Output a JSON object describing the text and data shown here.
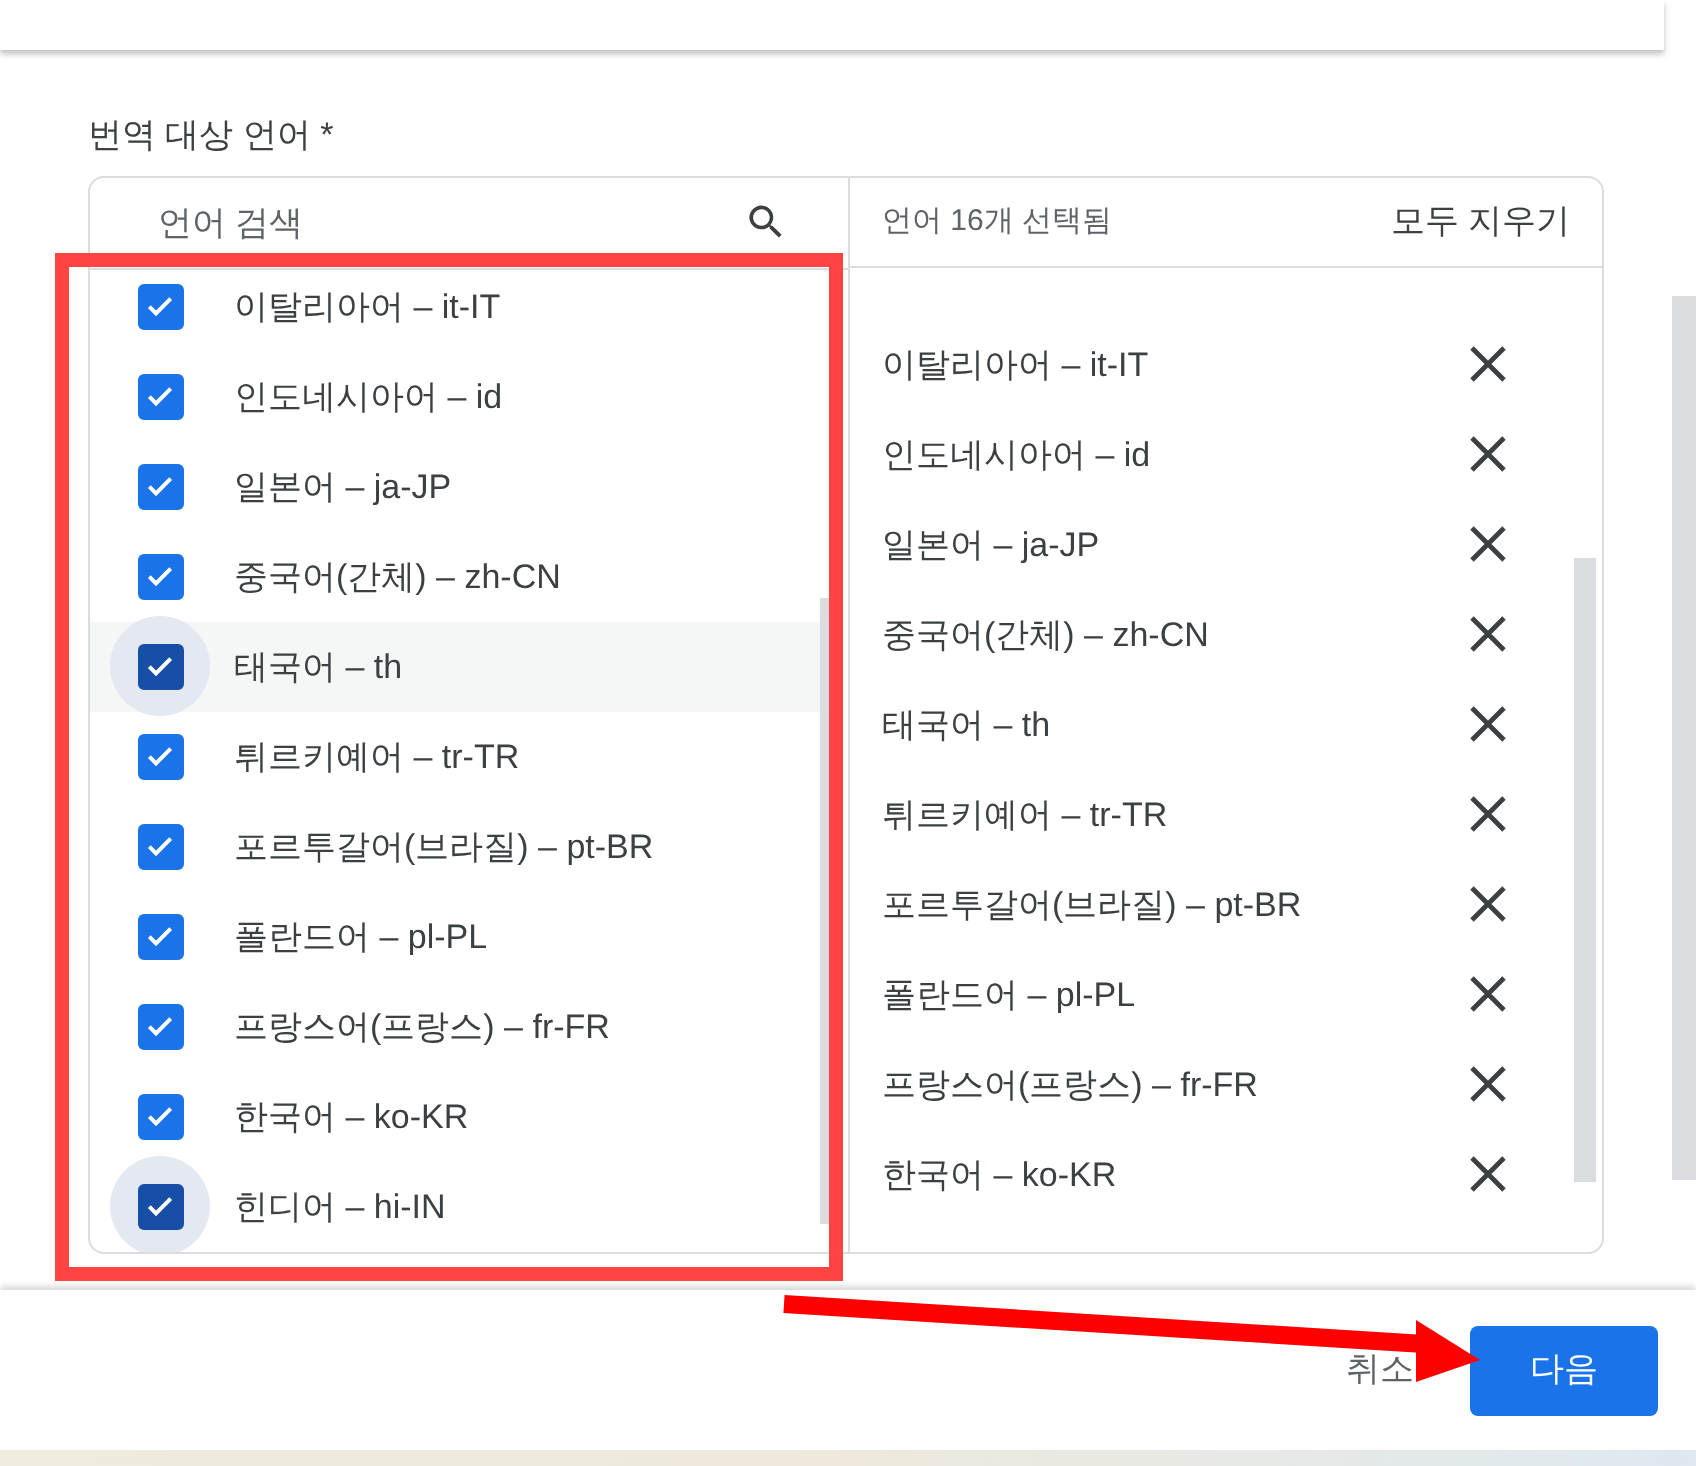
{
  "field_label": "번역 대상 언어 *",
  "search": {
    "placeholder": "언어 검색"
  },
  "languages": [
    {
      "label": "이탈리아어 – it-IT",
      "checked": true,
      "hover": false,
      "focus": false
    },
    {
      "label": "인도네시아어 – id",
      "checked": true,
      "hover": false,
      "focus": false
    },
    {
      "label": "일본어 – ja-JP",
      "checked": true,
      "hover": false,
      "focus": false
    },
    {
      "label": "중국어(간체) – zh-CN",
      "checked": true,
      "hover": false,
      "focus": false
    },
    {
      "label": "태국어 – th",
      "checked": true,
      "hover": true,
      "focus": true
    },
    {
      "label": "튀르키예어 – tr-TR",
      "checked": true,
      "hover": false,
      "focus": false
    },
    {
      "label": "포르투갈어(브라질) – pt-BR",
      "checked": true,
      "hover": false,
      "focus": false
    },
    {
      "label": "폴란드어 – pl-PL",
      "checked": true,
      "hover": false,
      "focus": false
    },
    {
      "label": "프랑스어(프랑스) – fr-FR",
      "checked": true,
      "hover": false,
      "focus": false
    },
    {
      "label": "한국어 – ko-KR",
      "checked": true,
      "hover": false,
      "focus": false
    },
    {
      "label": "힌디어 – hi-IN",
      "checked": true,
      "hover": false,
      "focus": true
    }
  ],
  "selected_header": {
    "count": "언어 16개 선택됨",
    "clear_all": "모두 지우기"
  },
  "selected_languages": [
    "이탈리아어 – it-IT",
    "인도네시아어 – id",
    "일본어 – ja-JP",
    "중국어(간체) – zh-CN",
    "태국어 – th",
    "튀르키예어 – tr-TR",
    "포르투갈어(브라질) – pt-BR",
    "폴란드어 – pl-PL",
    "프랑스어(프랑스) – fr-FR",
    "한국어 – ko-KR"
  ],
  "footer": {
    "cancel": "취소",
    "next": "다음"
  }
}
